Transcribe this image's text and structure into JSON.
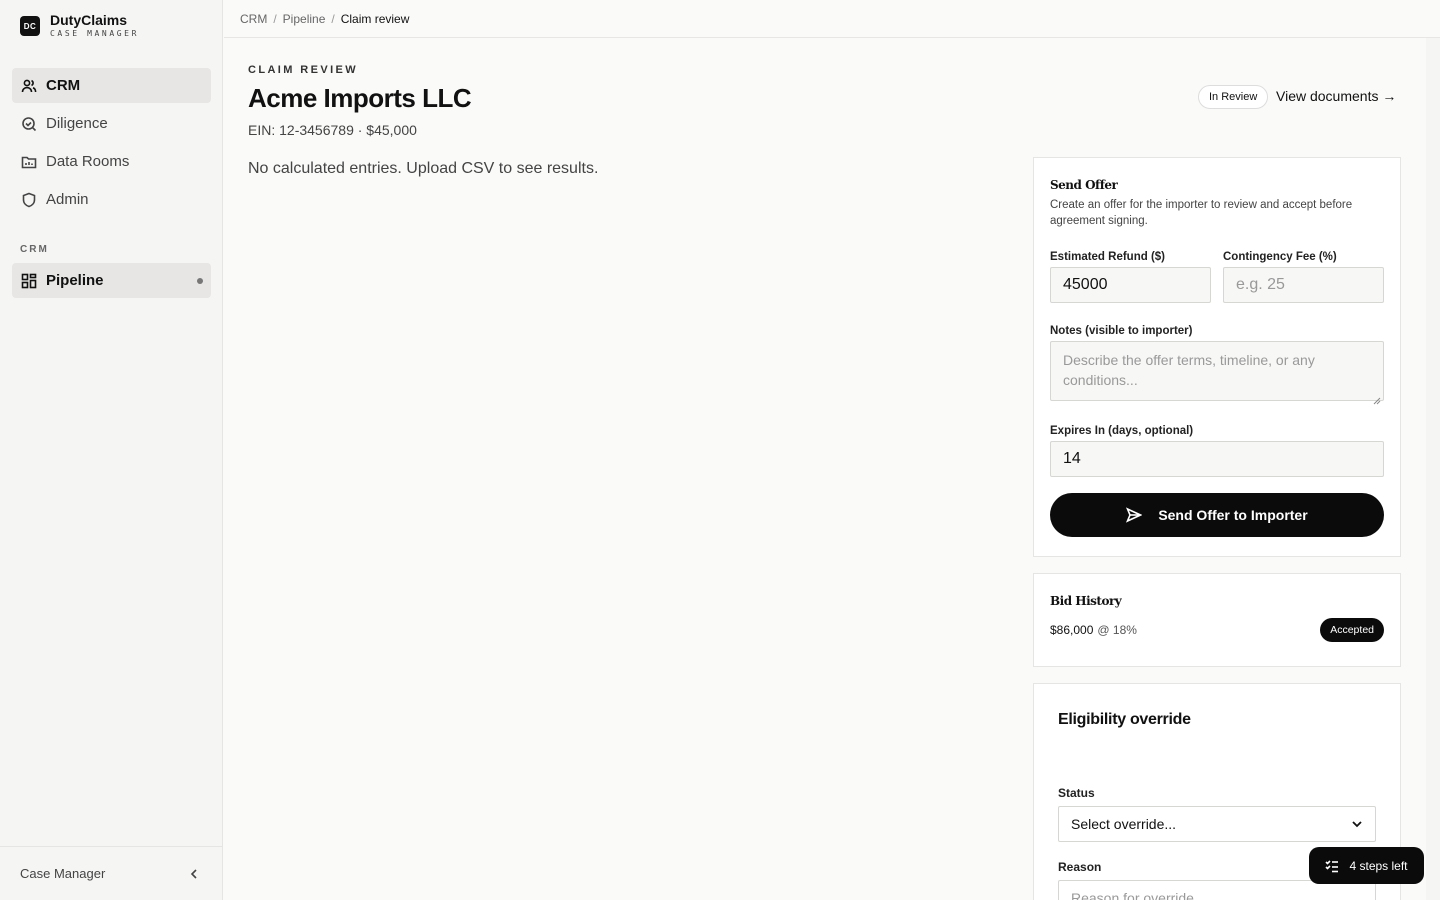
{
  "brand": {
    "logo": "DC",
    "name": "DutyClaims",
    "sub": "CASE MANAGER"
  },
  "sidebar": {
    "items": [
      {
        "label": "CRM",
        "icon": "users-icon"
      },
      {
        "label": "Diligence",
        "icon": "search-doc-icon"
      },
      {
        "label": "Data Rooms",
        "icon": "folder-chart-icon"
      },
      {
        "label": "Admin",
        "icon": "shield-icon"
      }
    ],
    "section_label": "CRM",
    "section_items": [
      {
        "label": "Pipeline",
        "icon": "grid-icon"
      }
    ],
    "footer_label": "Case Manager"
  },
  "breadcrumb": {
    "items": [
      "CRM",
      "Pipeline"
    ],
    "current": "Claim review",
    "separator": "/"
  },
  "page": {
    "eyebrow": "CLAIM REVIEW",
    "title": "Acme Imports LLC",
    "meta": "EIN: 12-3456789 · $45,000",
    "status": "In Review",
    "view_documents": "View documents →",
    "empty_message": "No calculated entries. Upload CSV to see results."
  },
  "offer": {
    "title": "Send Offer",
    "description": "Create an offer for the importer to review and accept before agreement signing.",
    "refund_label": "Estimated Refund ($)",
    "refund_value": "45000",
    "fee_label": "Contingency Fee (%)",
    "fee_placeholder": "e.g. 25",
    "notes_label": "Notes (visible to importer)",
    "notes_placeholder": "Describe the offer terms, timeline, or any conditions...",
    "expires_label": "Expires In (days, optional)",
    "expires_value": "14",
    "submit_label": "Send Offer to Importer"
  },
  "bids": {
    "title": "Bid History",
    "items": [
      {
        "amount": "$86,000",
        "rate": "@ 18%",
        "status": "Accepted"
      }
    ]
  },
  "eligibility": {
    "title": "Eligibility override",
    "status_label": "Status",
    "status_value": "Select override...",
    "reason_label": "Reason",
    "reason_placeholder": "Reason for override"
  },
  "steps": {
    "label": "4 steps left"
  },
  "colors": {
    "accent": "#0b0b0b",
    "sidebar_bg": "#f5f5f4",
    "active_bg": "#e7e6e4",
    "page_bg": "#fafaf9"
  }
}
